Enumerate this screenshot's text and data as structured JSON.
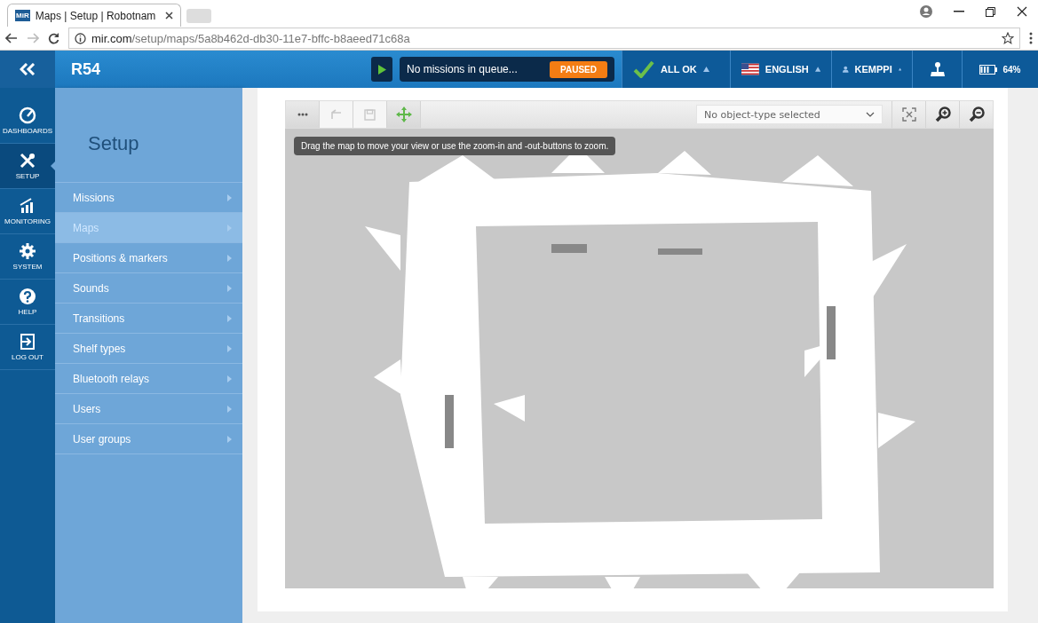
{
  "browser": {
    "tab_title": "Maps | Setup | Robotnam",
    "favicon": "MiR",
    "url_host": "mir.com",
    "url_path": "/setup/maps/5a8b462d-db30-11e7-bffc-b8aeed71c68a"
  },
  "header": {
    "title": "R54",
    "mission_status": "No missions in queue...",
    "badge": "PAUSED",
    "status_items": [
      {
        "kind": "status",
        "label": "ALL OK"
      },
      {
        "kind": "language",
        "label": "ENGLISH"
      },
      {
        "kind": "user",
        "label": "KEMPPI"
      }
    ],
    "battery": "64%"
  },
  "rail": [
    {
      "kind": "gauge",
      "label": "DASHBOARDS",
      "selected": false
    },
    {
      "kind": "tools",
      "label": "SETUP",
      "selected": true
    },
    {
      "kind": "chart",
      "label": "MONITORING",
      "selected": false
    },
    {
      "kind": "gear",
      "label": "SYSTEM",
      "selected": false
    },
    {
      "kind": "help",
      "label": "HELP",
      "selected": false
    },
    {
      "kind": "logout",
      "label": "LOG OUT",
      "selected": false
    }
  ],
  "setup": {
    "title": "Setup",
    "items": [
      {
        "label": "Missions",
        "selected": false
      },
      {
        "label": "Maps",
        "selected": true
      },
      {
        "label": "Positions & markers",
        "selected": false
      },
      {
        "label": "Sounds",
        "selected": false
      },
      {
        "label": "Transitions",
        "selected": false
      },
      {
        "label": "Shelf types",
        "selected": false
      },
      {
        "label": "Bluetooth relays",
        "selected": false
      },
      {
        "label": "Users",
        "selected": false
      },
      {
        "label": "User groups",
        "selected": false
      }
    ]
  },
  "map_editor": {
    "tools": [
      {
        "kind": "more",
        "disabled": false
      },
      {
        "kind": "undo",
        "disabled": true
      },
      {
        "kind": "save",
        "disabled": true
      },
      {
        "kind": "move",
        "disabled": false
      }
    ],
    "object_type": "No object-type selected",
    "view_tools": [
      {
        "kind": "fit"
      },
      {
        "kind": "zoom-in"
      },
      {
        "kind": "zoom-out"
      }
    ],
    "hint": "Drag the map to move your view or use the zoom-in and -out-buttons to zoom."
  }
}
